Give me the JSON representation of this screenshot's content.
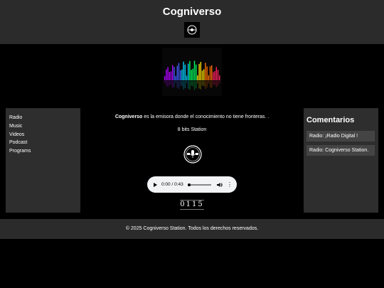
{
  "header": {
    "title": "Cogniverso",
    "logo_icon": "cogniverso-logo-icon"
  },
  "banner": {
    "icon": "audio-equalizer-banner",
    "colors": [
      "#b000ff",
      "#4060ff",
      "#00d0ff",
      "#00ff60",
      "#ffe000",
      "#ff7000",
      "#ff2060"
    ]
  },
  "sidebar": {
    "items": [
      {
        "label": "Radio"
      },
      {
        "label": "Music"
      },
      {
        "label": "Videos"
      },
      {
        "label": "Podcast"
      },
      {
        "label": "Programs"
      }
    ]
  },
  "main": {
    "intro_bold": "Cogniverso",
    "intro_rest": " es la emisora donde el conocimiento no tiene fronteras. .",
    "station_name": "8 bits Station",
    "station_logo_icon": "8bits-radio-logo-icon",
    "audio": {
      "time": "0:00 / 0:43",
      "progress": 0
    },
    "visit_counter": "0115"
  },
  "comments": {
    "title": "Comentarios",
    "items": [
      {
        "text": "Radio: ¡Radio Digital !"
      },
      {
        "text": "Radio: Cogniverso Station."
      }
    ]
  },
  "footer": {
    "text": "© 2025 Cogniverso Station. Todos los derechos reservados."
  }
}
